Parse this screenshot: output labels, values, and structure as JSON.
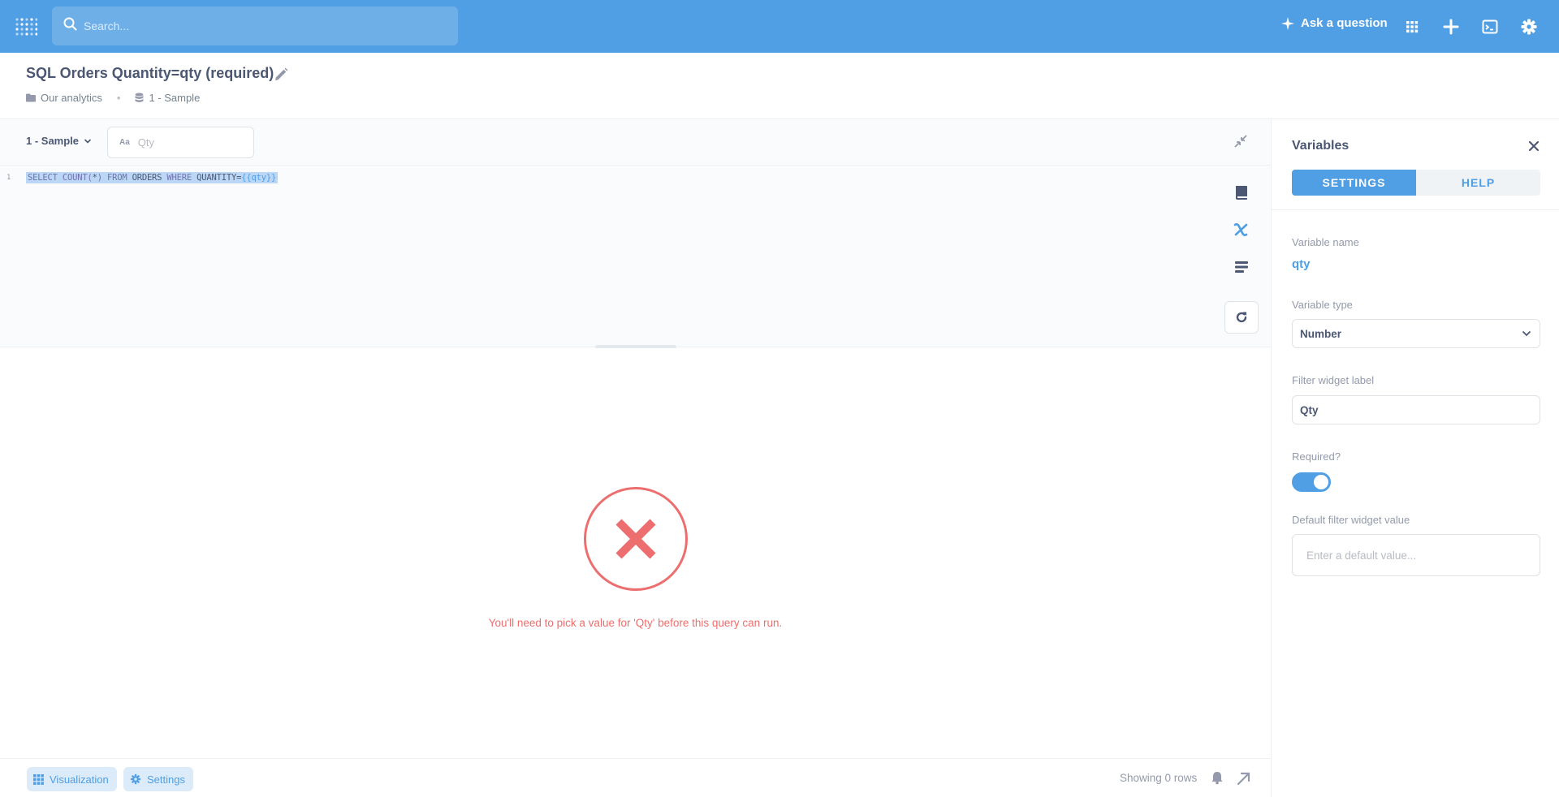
{
  "nav": {
    "search_placeholder": "Search...",
    "ask_label": "Ask a question",
    "icons": [
      "grid-icon",
      "plus-icon",
      "terminal-icon",
      "gear-icon"
    ]
  },
  "header": {
    "title": "SQL Orders Quantity=qty (required)",
    "collection": "Our analytics",
    "database": "1 - Sample"
  },
  "editor": {
    "database_select": "1 - Sample",
    "variable_widget_prefix": "Aa",
    "variable_widget_placeholder": "Qty",
    "line_number": "1",
    "sql_parts": {
      "select": "SELECT",
      "count": " COUNT(",
      "star": "*",
      "close": ")",
      "from": " FROM",
      "orders": " ORDERS",
      "where": " WHERE",
      "quantity": " QUANTITY=",
      "tag": "{{qty}}"
    }
  },
  "results": {
    "error_message": "You'll need to pick a value for 'Qty' before this query can run."
  },
  "footer": {
    "visualization_label": "Visualization",
    "settings_label": "Settings",
    "rows_label": "Showing 0 rows"
  },
  "panel": {
    "title": "Variables",
    "tab_settings": "SETTINGS",
    "tab_help": "HELP",
    "variable_name_label": "Variable name",
    "variable_name": "qty",
    "variable_type_label": "Variable type",
    "variable_type": "Number",
    "filter_label_label": "Filter widget label",
    "filter_label_value": "Qty",
    "required_label": "Required?",
    "required": true,
    "default_label": "Default filter widget value",
    "default_placeholder": "Enter a default value..."
  },
  "colors": {
    "brand": "#509ee3",
    "error": "#ed6e6e",
    "text": "#4c5773"
  }
}
